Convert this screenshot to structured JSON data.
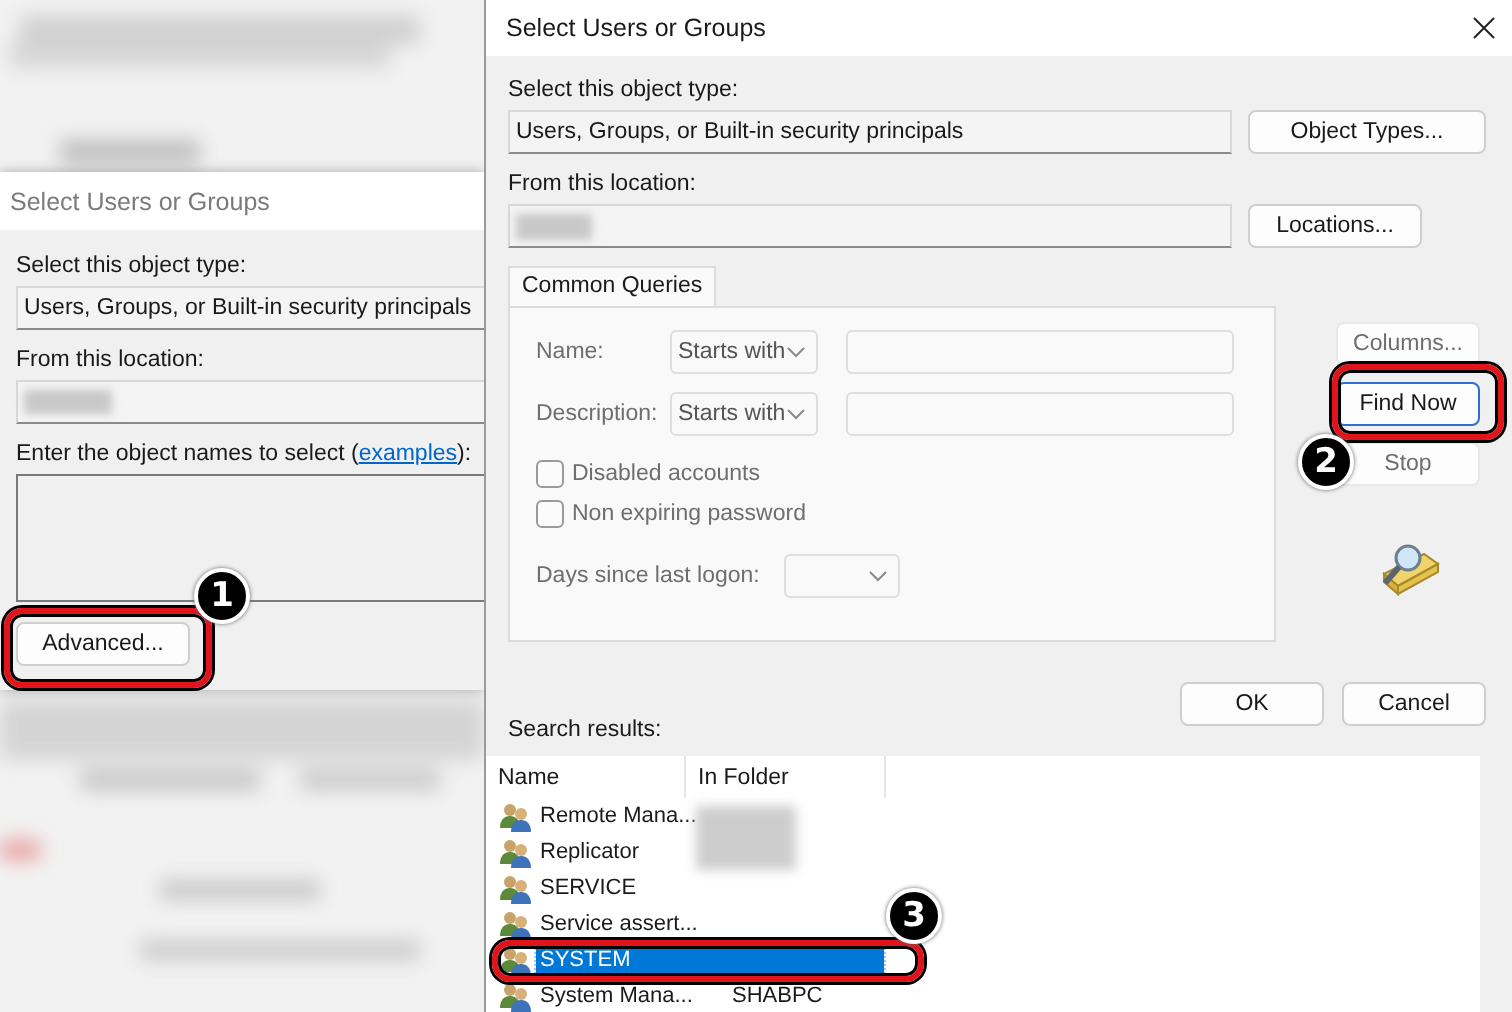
{
  "background_dialog": {
    "title": "Select Users or Groups",
    "object_type_label": "Select this object type:",
    "object_type_value": "Users, Groups, or Built-in security principals",
    "location_label": "From this location:",
    "names_label": {
      "before": "Enter the object names to select (",
      "link": "examples",
      "after": "):"
    },
    "advanced_button": "Advanced..."
  },
  "dialog": {
    "title": "Select Users or Groups",
    "object_type_label": "Select this object type:",
    "object_type_value": "Users, Groups, or Built-in security principals",
    "object_types_button": "Object Types...",
    "location_label": "From this location:",
    "locations_button": "Locations...",
    "tabs": [
      {
        "label": "Common Queries",
        "selected": true
      }
    ],
    "queries": [
      {
        "label": "Name:",
        "match": "Starts with"
      },
      {
        "label": "Description:",
        "match": "Starts with"
      }
    ],
    "checkboxes": [
      {
        "label": "Disabled accounts",
        "checked": false
      },
      {
        "label": "Non expiring password",
        "checked": false
      }
    ],
    "days_label": "Days since last logon:",
    "side_buttons": [
      {
        "label": "Columns...",
        "disabled": true,
        "focused": false
      },
      {
        "label": "Find Now",
        "disabled": false,
        "focused": true
      },
      {
        "label": "Stop",
        "disabled": true,
        "focused": false
      }
    ],
    "ok_button": "OK",
    "cancel_button": "Cancel",
    "results_label": "Search results:",
    "results": {
      "columns": [
        "Name",
        "In Folder"
      ],
      "rows": [
        {
          "name": "Remote Mana...",
          "folder": "",
          "selected": false
        },
        {
          "name": "Replicator",
          "folder": "",
          "selected": false
        },
        {
          "name": "SERVICE",
          "folder": "",
          "selected": false
        },
        {
          "name": "Service assert...",
          "folder": "",
          "selected": false
        },
        {
          "name": "SYSTEM",
          "folder": "",
          "selected": true
        },
        {
          "name": "System Mana...",
          "folder": "SHABPC",
          "selected": false
        }
      ]
    }
  },
  "annotations": [
    {
      "number": "1"
    },
    {
      "number": "2"
    },
    {
      "number": "3"
    }
  ]
}
